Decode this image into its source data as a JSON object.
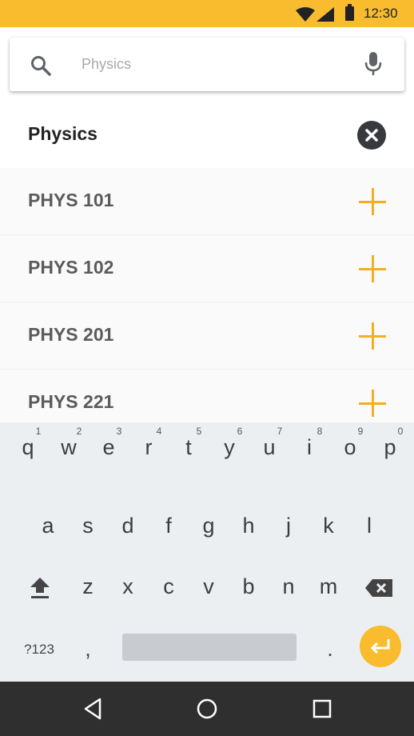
{
  "status_bar": {
    "time": "12:30"
  },
  "search": {
    "placeholder": "Physics",
    "value": ""
  },
  "selected": {
    "title": "Physics"
  },
  "results": [
    {
      "label": "PHYS 101"
    },
    {
      "label": "PHYS 102"
    },
    {
      "label": "PHYS 201"
    },
    {
      "label": "PHYS 221"
    }
  ],
  "keyboard": {
    "row1": [
      {
        "ch": "q",
        "hint": "1"
      },
      {
        "ch": "w",
        "hint": "2"
      },
      {
        "ch": "e",
        "hint": "3"
      },
      {
        "ch": "r",
        "hint": "4"
      },
      {
        "ch": "t",
        "hint": "5"
      },
      {
        "ch": "y",
        "hint": "6"
      },
      {
        "ch": "u",
        "hint": "7"
      },
      {
        "ch": "i",
        "hint": "8"
      },
      {
        "ch": "o",
        "hint": "9"
      },
      {
        "ch": "p",
        "hint": "0"
      }
    ],
    "row2": [
      "a",
      "s",
      "d",
      "f",
      "g",
      "h",
      "j",
      "k",
      "l"
    ],
    "row3": [
      "z",
      "x",
      "c",
      "v",
      "b",
      "n",
      "m"
    ],
    "numbers_label": "?123",
    "comma": ",",
    "period": "."
  },
  "colors": {
    "accent": "#f9bc2f",
    "plus": "#f5ad22",
    "nav_bg": "#2f2f2f",
    "keyboard_bg": "#eceff1"
  }
}
